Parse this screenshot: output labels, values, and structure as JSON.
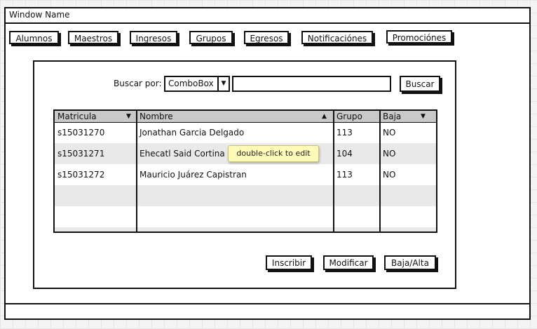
{
  "window": {
    "title": "Window Name"
  },
  "nav": {
    "items": [
      {
        "label": "Alumnos"
      },
      {
        "label": "Maestros"
      },
      {
        "label": "Ingresos"
      },
      {
        "label": "Grupos"
      },
      {
        "label": "Egresos"
      },
      {
        "label": "Notificaciónes"
      },
      {
        "label": "Promociónes"
      }
    ]
  },
  "search": {
    "label": "Buscar por:",
    "combo_value": "ComboBox",
    "input_value": "",
    "button_label": "Buscar"
  },
  "table": {
    "columns": [
      {
        "label": "Matricula",
        "sort": "▼"
      },
      {
        "label": "Nombre",
        "sort": "▲"
      },
      {
        "label": "Grupo",
        "sort": ""
      },
      {
        "label": "Baja",
        "sort": "▼"
      }
    ],
    "rows": [
      {
        "matricula": "s15031270",
        "nombre": "Jonathan Garcia Delgado",
        "grupo": "113",
        "baja": "NO"
      },
      {
        "matricula": "s15031271",
        "nombre": "Ehecatl Said Cortina G",
        "grupo": "104",
        "baja": "NO"
      },
      {
        "matricula": "s15031272",
        "nombre": "Mauricio Juárez Capistran",
        "grupo": "113",
        "baja": "NO"
      }
    ]
  },
  "tooltip": {
    "text": "double-click to edit"
  },
  "actions": {
    "inscribir": "Inscribir",
    "modificar": "Modificar",
    "baja_alta": "Baja/Alta"
  }
}
